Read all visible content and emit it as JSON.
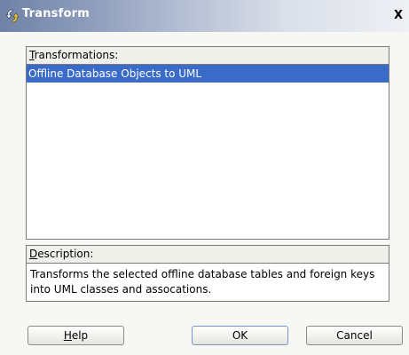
{
  "window": {
    "title": "Transform",
    "close_label": "X"
  },
  "transformations": {
    "label_mnemonic": "T",
    "label_rest": "ransformations:",
    "items": [
      {
        "label": "Offline Database Objects to UML",
        "selected": true
      }
    ]
  },
  "description": {
    "label_mnemonic": "D",
    "label_rest": "escription:",
    "text": "Transforms the selected offline database tables and foreign keys into UML classes and assocations."
  },
  "buttons": {
    "help_mnemonic": "H",
    "help_rest": "elp",
    "ok": "OK",
    "cancel": "Cancel"
  },
  "colors": {
    "selection": "#3a6bc8",
    "titlebar_start": "#6f82a6",
    "titlebar_end": "#eef0f4"
  }
}
